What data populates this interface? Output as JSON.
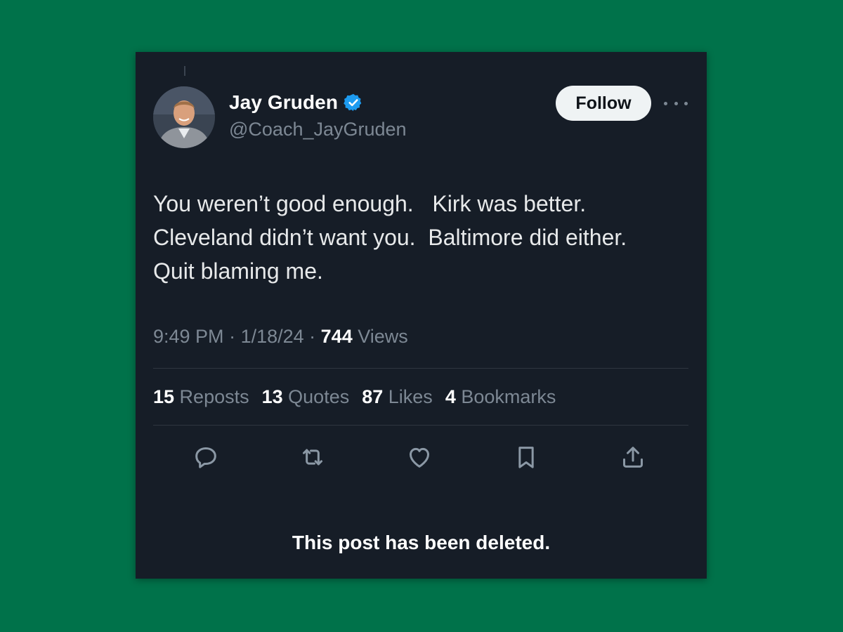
{
  "author": {
    "display_name": "Jay Gruden",
    "handle": "@Coach_JayGruden",
    "verified": true
  },
  "follow_label": "Follow",
  "tweet": {
    "lines": [
      "You weren’t good enough.   Kirk was better.",
      "Cleveland didn’t want you.  Baltimore did either.",
      "Quit blaming me."
    ]
  },
  "meta": {
    "time": "9:49 PM",
    "separator": " · ",
    "date": "1/18/24",
    "views_count": "744",
    "views_label": " Views"
  },
  "stats": [
    {
      "count": "15",
      "label": " Reposts"
    },
    {
      "count": "13",
      "label": " Quotes"
    },
    {
      "count": "87",
      "label": " Likes"
    },
    {
      "count": "4",
      "label": " Bookmarks"
    }
  ],
  "actions": [
    "reply-icon",
    "repost-icon",
    "like-icon",
    "bookmark-icon",
    "share-icon"
  ],
  "deleted_notice": "This post has been deleted.",
  "colors": {
    "background": "#00724a",
    "card": "#161d27",
    "verified": "#1d9bf0",
    "muted_text": "#7d8894",
    "icon": "#8b98a5"
  }
}
